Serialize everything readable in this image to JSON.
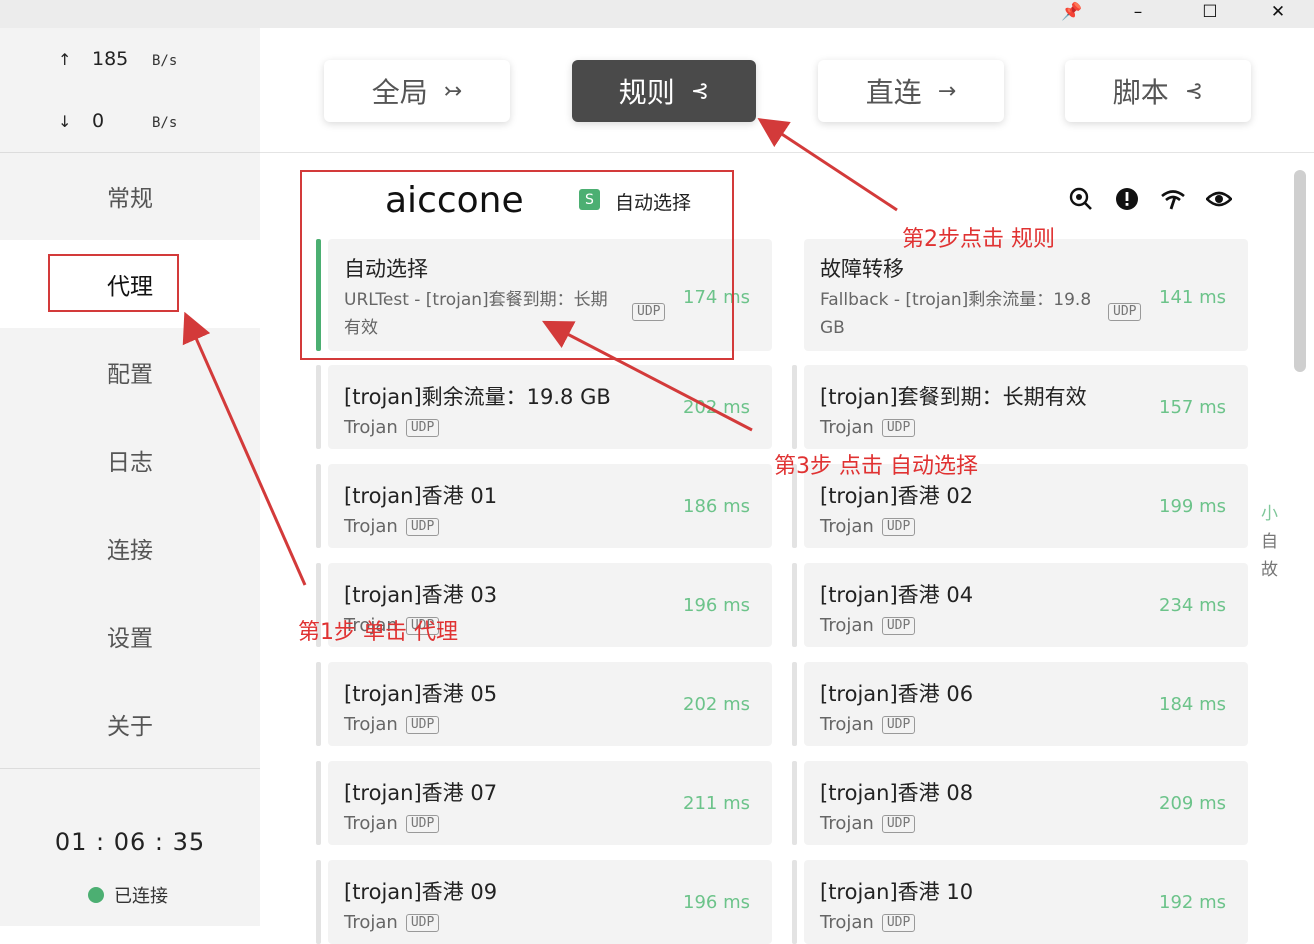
{
  "titlebar": {
    "pin": "📌",
    "minimize": "–",
    "maximize": "☐",
    "close": "✕"
  },
  "traffic": {
    "up": {
      "arrow": "↑",
      "value": "185",
      "unit": "B/s"
    },
    "down": {
      "arrow": "↓",
      "value": "0",
      "unit": "B/s"
    }
  },
  "nav": [
    "常规",
    "代理",
    "配置",
    "日志",
    "连接",
    "设置",
    "关于"
  ],
  "status": {
    "timer": "01 : 06 : 35",
    "connected": "已连接"
  },
  "modes": [
    {
      "label": "全局",
      "icon": "↣"
    },
    {
      "label": "规则",
      "icon": "⊰"
    },
    {
      "label": "直连",
      "icon": "→"
    },
    {
      "label": "脚本",
      "icon": "⊰"
    }
  ],
  "group": {
    "title": "aiccone",
    "badge": "S",
    "now": "自动选择",
    "tools": [
      "locate-icon",
      "alert-icon",
      "speed-icon",
      "eye-icon"
    ]
  },
  "special_cards": [
    {
      "name": "自动选择",
      "sub": "URLTest - [trojan]套餐到期：长期有效",
      "udp": "UDP",
      "delay": "174 ms"
    },
    {
      "name": "故障转移",
      "sub": "Fallback - [trojan]剩余流量：19.8 GB",
      "udp": "UDP",
      "delay": "141 ms"
    }
  ],
  "proxies": [
    {
      "name": "[trojan]剩余流量：19.8 GB",
      "type": "Trojan",
      "udp": "UDP",
      "delay": "202 ms"
    },
    {
      "name": "[trojan]套餐到期：长期有效",
      "type": "Trojan",
      "udp": "UDP",
      "delay": "157 ms"
    },
    {
      "name": "[trojan]香港 01",
      "type": "Trojan",
      "udp": "UDP",
      "delay": "186 ms"
    },
    {
      "name": "[trojan]香港 02",
      "type": "Trojan",
      "udp": "UDP",
      "delay": "199 ms"
    },
    {
      "name": "[trojan]香港 03",
      "type": "Trojan",
      "udp": "UDP",
      "delay": "196 ms"
    },
    {
      "name": "[trojan]香港 04",
      "type": "Trojan",
      "udp": "UDP",
      "delay": "234 ms"
    },
    {
      "name": "[trojan]香港 05",
      "type": "Trojan",
      "udp": "UDP",
      "delay": "202 ms"
    },
    {
      "name": "[trojan]香港 06",
      "type": "Trojan",
      "udp": "UDP",
      "delay": "184 ms"
    },
    {
      "name": "[trojan]香港 07",
      "type": "Trojan",
      "udp": "UDP",
      "delay": "211 ms"
    },
    {
      "name": "[trojan]香港 08",
      "type": "Trojan",
      "udp": "UDP",
      "delay": "209 ms"
    },
    {
      "name": "[trojan]香港 09",
      "type": "Trojan",
      "udp": "UDP",
      "delay": "196 ms"
    },
    {
      "name": "[trojan]香港 10",
      "type": "Trojan",
      "udp": "UDP",
      "delay": "192 ms"
    }
  ],
  "side_letters": [
    "小",
    "自",
    "故"
  ],
  "annotations": {
    "step1": "第1步 单击 代理",
    "step2": "第2步点击 规则",
    "step3": "第3步 点击 自动选择"
  },
  "colors": {
    "accent": "#4caf72",
    "annotation": "#e03232",
    "active_mode": "#4a4a4a"
  }
}
